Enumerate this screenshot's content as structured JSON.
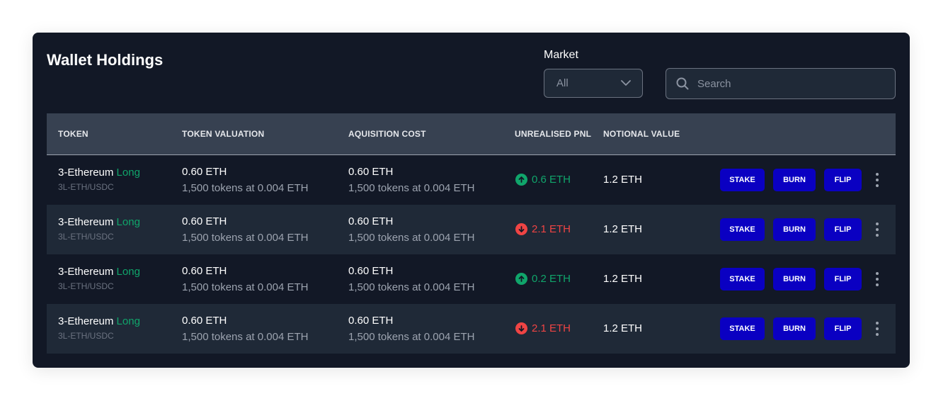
{
  "header": {
    "title": "Wallet Holdings",
    "market_label": "Market",
    "market_value": "All",
    "search_placeholder": "Search"
  },
  "columns": [
    "TOKEN",
    "TOKEN VALUATION",
    "AQUISITION COST",
    "UNREALISED PNL",
    "NOTIONAL VALUE"
  ],
  "actions": {
    "stake": "STAKE",
    "burn": "BURN",
    "flip": "FLIP"
  },
  "colors": {
    "accent_button": "#0a00c2",
    "positive": "#10a56b",
    "negative": "#ef4444"
  },
  "rows": [
    {
      "token_name": "3-Ethereum",
      "token_side": "Long",
      "token_pair": "3L-ETH/USDC",
      "valuation": "0.60 ETH",
      "valuation_detail": "1,500 tokens at 0.004 ETH",
      "cost": "0.60 ETH",
      "cost_detail": "1,500 tokens at 0.004 ETH",
      "pnl": "0.6 ETH",
      "pnl_direction": "up",
      "notional": "1.2 ETH"
    },
    {
      "token_name": "3-Ethereum",
      "token_side": "Long",
      "token_pair": "3L-ETH/USDC",
      "valuation": "0.60 ETH",
      "valuation_detail": "1,500 tokens at 0.004 ETH",
      "cost": "0.60 ETH",
      "cost_detail": "1,500 tokens at 0.004 ETH",
      "pnl": "2.1 ETH",
      "pnl_direction": "down",
      "notional": "1.2 ETH"
    },
    {
      "token_name": "3-Ethereum",
      "token_side": "Long",
      "token_pair": "3L-ETH/USDC",
      "valuation": "0.60 ETH",
      "valuation_detail": "1,500 tokens at 0.004 ETH",
      "cost": "0.60 ETH",
      "cost_detail": "1,500 tokens at 0.004 ETH",
      "pnl": "0.2 ETH",
      "pnl_direction": "up",
      "notional": "1.2 ETH"
    },
    {
      "token_name": "3-Ethereum",
      "token_side": "Long",
      "token_pair": "3L-ETH/USDC",
      "valuation": "0.60 ETH",
      "valuation_detail": "1,500 tokens at 0.004 ETH",
      "cost": "0.60 ETH",
      "cost_detail": "1,500 tokens at 0.004 ETH",
      "pnl": "2.1 ETH",
      "pnl_direction": "down",
      "notional": "1.2 ETH"
    }
  ]
}
